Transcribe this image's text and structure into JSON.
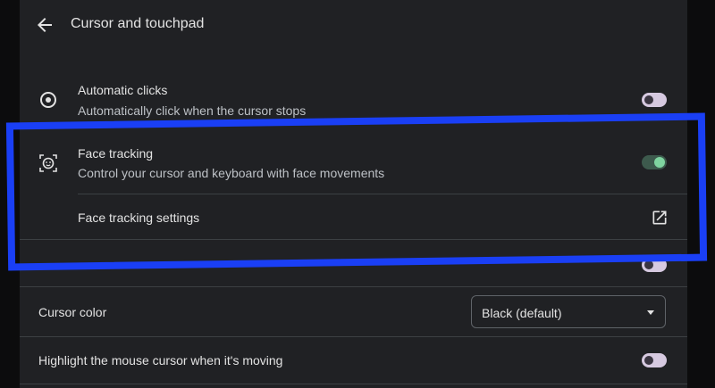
{
  "header": {
    "title": "Cursor and touchpad"
  },
  "automatic_clicks": {
    "title": "Automatic clicks",
    "subtitle": "Automatically click when the cursor stops",
    "enabled": false
  },
  "face_tracking": {
    "title": "Face tracking",
    "subtitle": "Control your cursor and keyboard with face movements",
    "enabled": true,
    "settings_label": "Face tracking settings"
  },
  "cursor_color": {
    "label": "Cursor color",
    "selected": "Black (default)"
  },
  "highlight_cursor": {
    "label": "Highlight the mouse cursor when it's moving",
    "enabled": false
  },
  "colors": {
    "annotation_border": "#1a3ff5",
    "toggle_on_knob": "#7fd4a0",
    "toggle_off_track": "#d6c9e0"
  }
}
